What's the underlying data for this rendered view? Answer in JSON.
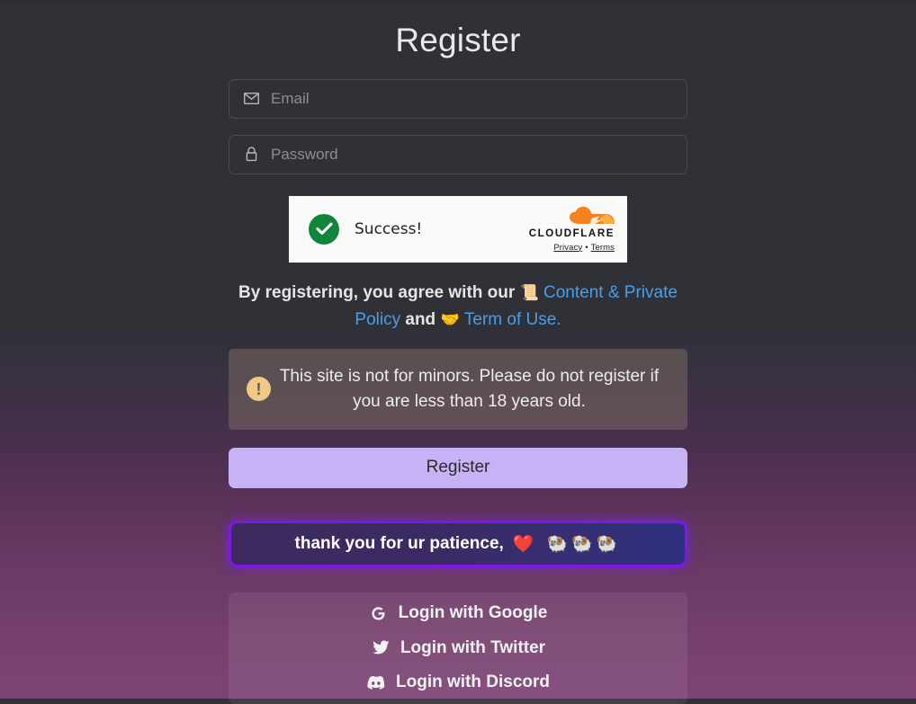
{
  "page": {
    "title": "Register"
  },
  "form": {
    "email": {
      "icon": "envelope-icon",
      "placeholder": "Email",
      "value": ""
    },
    "password": {
      "icon": "lock-icon",
      "placeholder": "Password",
      "value": ""
    }
  },
  "captcha": {
    "provider": "Cloudflare",
    "status_label": "Success!",
    "status_icon": "green-check-circle-icon",
    "brand_word": "CLOUDFLARE",
    "privacy_label": "Privacy",
    "separator": "•",
    "terms_label": "Terms",
    "background": "#fafafa",
    "check_color": "#11863a"
  },
  "terms": {
    "lead": "By registering, you agree with our",
    "doc_emoji": "📜",
    "content_policy_link": "Content & Private Policy",
    "conjunction": "and",
    "handshake_emoji": "🤝",
    "terms_link": "Term of Use.",
    "link_color": "#4a9eea"
  },
  "warning": {
    "icon": "exclamation-circle-icon",
    "icon_color": "#f0c987",
    "text": "This site is not for minors. Please do not register if you are less than 18 years old."
  },
  "actions": {
    "register_label": "Register",
    "register_bg": "#c7b2f5"
  },
  "announcement": {
    "text": "thank you for ur patience,",
    "heart_emoji": "❤️",
    "sheep_emojis": "🐏🐏🐏",
    "border_color": "#7d19e6"
  },
  "social": {
    "items": [
      {
        "icon": "google-icon",
        "label": "Login with Google"
      },
      {
        "icon": "twitter-icon",
        "label": "Login with Twitter"
      },
      {
        "icon": "discord-icon",
        "label": "Login with Discord"
      }
    ]
  }
}
